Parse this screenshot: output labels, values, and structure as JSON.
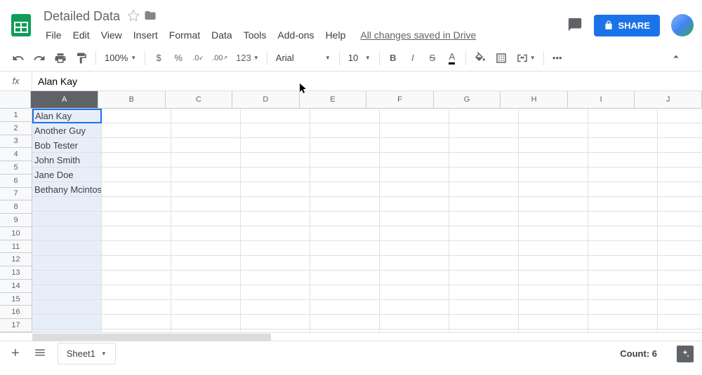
{
  "doc": {
    "title": "Detailed Data",
    "save_status": "All changes saved in Drive"
  },
  "menu": {
    "file": "File",
    "edit": "Edit",
    "view": "View",
    "insert": "Insert",
    "format": "Format",
    "data": "Data",
    "tools": "Tools",
    "addons": "Add-ons",
    "help": "Help"
  },
  "share": {
    "label": "SHARE"
  },
  "toolbar": {
    "zoom": "100%",
    "currency": "$",
    "percent": "%",
    "dec_decrease": ".0",
    "dec_increase": ".00",
    "more_formats": "123",
    "font": "Arial",
    "font_size": "10",
    "bold": "B",
    "italic": "I",
    "strike": "S",
    "text_color": "A"
  },
  "formula": {
    "fx": "fx",
    "value": "Alan Kay"
  },
  "columns": [
    "A",
    "B",
    "C",
    "D",
    "E",
    "F",
    "G",
    "H",
    "I",
    "J"
  ],
  "rows": [
    1,
    2,
    3,
    4,
    5,
    6,
    7,
    8,
    9,
    10,
    11,
    12,
    13,
    14,
    15,
    16,
    17
  ],
  "cells": {
    "A1": "Alan Kay",
    "A2": "Another Guy",
    "A3": "Bob Tester",
    "A4": "John Smith",
    "A5": "Jane Doe",
    "A6": "Bethany Mcintosh"
  },
  "sheets": {
    "sheet1": "Sheet1"
  },
  "footer": {
    "count": "Count: 6"
  }
}
